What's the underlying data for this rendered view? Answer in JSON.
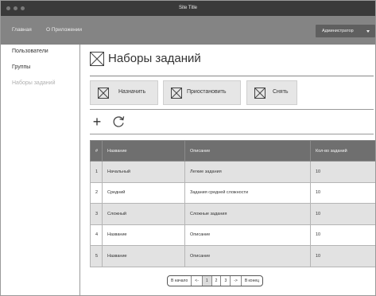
{
  "window": {
    "title": "Site Title"
  },
  "nav": {
    "items": [
      {
        "label": "Главная"
      },
      {
        "label": "О Приложении"
      }
    ],
    "user_menu": {
      "selected": "Администратор"
    }
  },
  "sidebar": {
    "items": [
      {
        "label": "Пользователи",
        "active": false
      },
      {
        "label": "Группы",
        "active": false
      },
      {
        "label": "Наборы заданий",
        "active": true
      }
    ]
  },
  "page": {
    "title": "Наборы заданий"
  },
  "actions": {
    "assign": "Назначить",
    "suspend": "Приостановить",
    "remove": "Снять"
  },
  "toolbar": {
    "add_icon": "plus-icon",
    "refresh_icon": "refresh-icon"
  },
  "table": {
    "columns": [
      "#",
      "Название",
      "Описание",
      "Кол-во заданий"
    ],
    "rows": [
      [
        "1",
        "Начальный",
        "Легкие задания",
        "10"
      ],
      [
        "2",
        "Средний",
        "Задания средней сложности",
        "10"
      ],
      [
        "3",
        "Сложный",
        "Сложные задания",
        "10"
      ],
      [
        "4",
        "Название",
        "Описание",
        "10"
      ],
      [
        "5",
        "Название",
        "Описание",
        "10"
      ]
    ]
  },
  "pagination": {
    "first": "В начало",
    "prev": "<-",
    "pages": [
      "1",
      "2",
      "3"
    ],
    "current": "1",
    "next": "->",
    "last": "В конец"
  },
  "colors": {
    "titlebar": "#3a3a3a",
    "navbar": "#848484",
    "user_menu": "#5f5f5f",
    "table_header": "#6f6f6f",
    "row_alt": "#e2e2e2",
    "button_bg": "#e6e6e6"
  }
}
